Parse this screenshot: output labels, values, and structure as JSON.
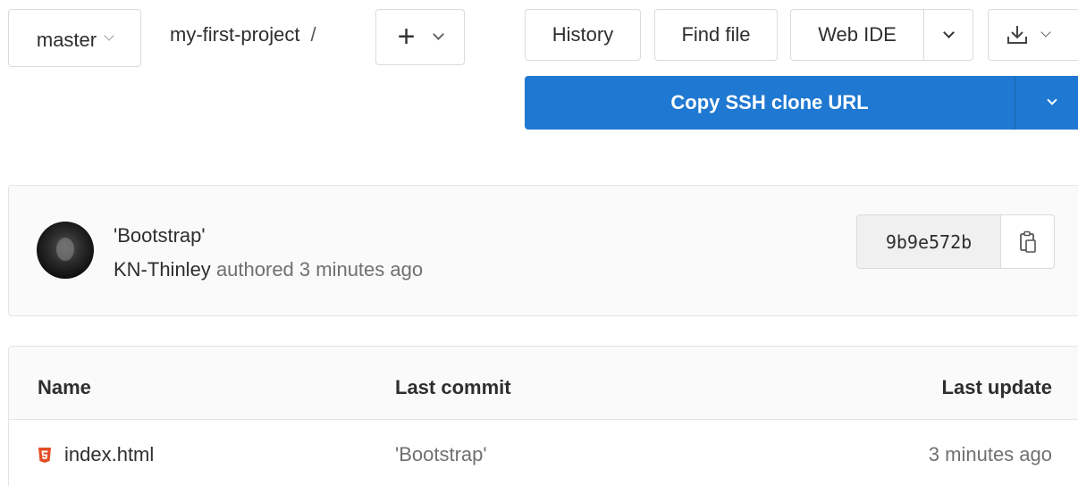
{
  "toolbar": {
    "branch": "master",
    "path": "my-first-project",
    "path_separator": "/",
    "history_label": "History",
    "find_file_label": "Find file",
    "web_ide_label": "Web IDE",
    "clone_label": "Copy SSH clone URL"
  },
  "commit": {
    "title": "'Bootstrap'",
    "author": "KN-Thinley",
    "meta": "authored 3 minutes ago",
    "sha": "9b9e572b"
  },
  "files": {
    "columns": [
      "Name",
      "Last commit",
      "Last update"
    ],
    "rows": [
      {
        "name": "index.html",
        "icon": "html5-icon",
        "last_commit": "'Bootstrap'",
        "last_update": "3 minutes ago"
      }
    ]
  },
  "colors": {
    "primary": "#1f78d1",
    "html_icon": "#e44d26"
  }
}
